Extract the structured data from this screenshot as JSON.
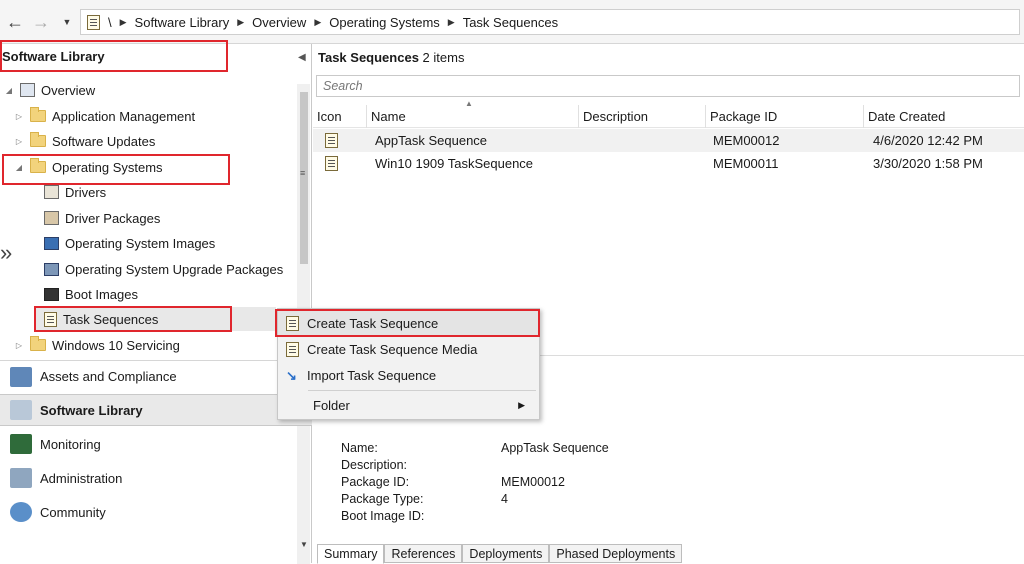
{
  "breadcrumb": {
    "root": "\\",
    "items": [
      "Software Library",
      "Overview",
      "Operating Systems",
      "Task Sequences"
    ]
  },
  "nav": {
    "title": "Software Library",
    "tree": {
      "overview": "Overview",
      "application_management": "Application Management",
      "software_updates": "Software Updates",
      "operating_systems": "Operating Systems",
      "drivers": "Drivers",
      "driver_packages": "Driver Packages",
      "os_images": "Operating System Images",
      "os_upgrade_packages": "Operating System Upgrade Packages",
      "boot_images": "Boot Images",
      "task_sequences": "Task Sequences",
      "win10_servicing": "Windows 10 Servicing"
    },
    "workspaces": [
      "Assets and Compliance",
      "Software Library",
      "Monitoring",
      "Administration",
      "Community"
    ],
    "collapse_glyph": "»"
  },
  "main": {
    "header": {
      "title": "Task Sequences",
      "count": "2 items"
    },
    "search_placeholder": "Search",
    "columns": [
      "Icon",
      "Name",
      "Description",
      "Package ID",
      "Date Created"
    ],
    "rows": [
      {
        "name": "AppTask Sequence",
        "description": "",
        "package_id": "MEM00012",
        "date_created": "4/6/2020 12:42 PM"
      },
      {
        "name": "Win10 1909 TaskSequence",
        "description": "",
        "package_id": "MEM00011",
        "date_created": "3/30/2020 1:58 PM"
      }
    ]
  },
  "context_menu": {
    "items": [
      "Create Task Sequence",
      "Create Task Sequence Media",
      "Import Task Sequence",
      "Folder"
    ]
  },
  "details": {
    "labels": [
      "Name:",
      "Description:",
      "Package ID:",
      "Package Type:",
      "Boot Image ID:"
    ],
    "values": {
      "name": "AppTask Sequence",
      "description": "",
      "package_id": "MEM00012",
      "package_type": "4",
      "boot_image_id": ""
    },
    "tabs": [
      "Summary",
      "References",
      "Deployments",
      "Phased Deployments"
    ]
  },
  "colors": {
    "highlight": "#e0262d",
    "selected_row": "#e5f0fb",
    "accent": "#0a64c8"
  }
}
